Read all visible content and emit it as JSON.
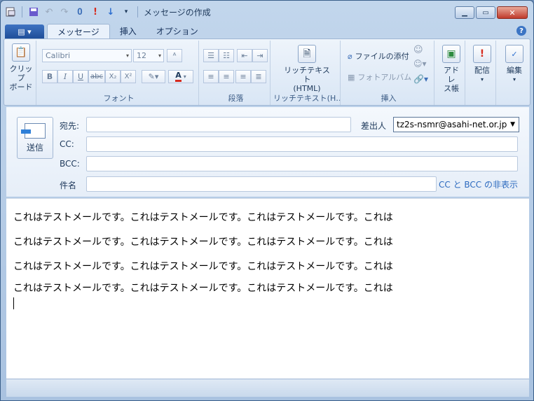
{
  "window": {
    "title": "メッセージの作成"
  },
  "tabs": [
    {
      "label": "メッセージ",
      "active": true
    },
    {
      "label": "挿入",
      "active": false
    },
    {
      "label": "オプション",
      "active": false
    }
  ],
  "ribbon": {
    "clipboard": {
      "label_line1": "クリップ",
      "label_line2": "ボード"
    },
    "font": {
      "group_label": "フォント",
      "font_name": "Calibri",
      "font_size": "12",
      "bold": "B",
      "italic": "I",
      "underline": "U",
      "strike": "abc",
      "subscript": "X₂",
      "superscript": "X²",
      "font_color": "A"
    },
    "paragraph": {
      "group_label": "段落"
    },
    "richtext": {
      "label_line1": "リッチテキスト",
      "label_line2": "(HTML)",
      "group_label": "リッチテキスト(H…"
    },
    "insert": {
      "group_label": "挿入",
      "attach_label": "ファイルの添付",
      "photo_album_label": "フォトアルバム"
    },
    "address_book": {
      "label_line1": "アドレ",
      "label_line2": "ス帳"
    },
    "delivery": {
      "label": "配信"
    },
    "edit": {
      "label": "編集"
    }
  },
  "compose": {
    "send_label": "送信",
    "to_label": "宛先:",
    "cc_label": "CC:",
    "bcc_label": "BCC:",
    "subject_label": "件名",
    "from_label": "差出人",
    "from_value": "tz2s-nsmr@asahi-net.or.jp",
    "hide_cc_bcc_link": "CC と BCC の非表示",
    "to_value": "",
    "cc_value": "",
    "bcc_value": "",
    "subject_value": ""
  },
  "body": {
    "lines": [
      "これはテストメールです。これはテストメールです。これはテストメールです。これは",
      "これはテストメールです。これはテストメールです。これはテストメールです。これは",
      "これはテストメールです。これはテストメールです。これはテストメールです。これは",
      "これはテストメールです。これはテストメールです。これはテストメールです。これは"
    ]
  },
  "colors": {
    "accent": "#1f4e99",
    "link": "#2d6bbf",
    "close_button": "#c0392b"
  }
}
